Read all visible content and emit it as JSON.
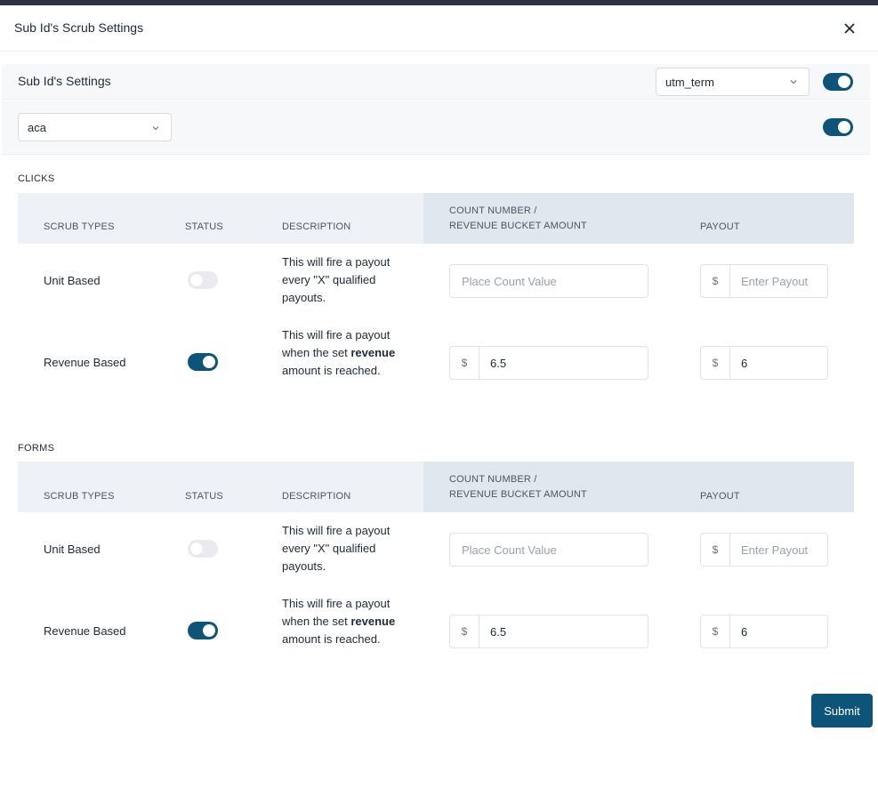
{
  "modal": {
    "title": "Sub Id's Scrub Settings"
  },
  "settings": {
    "title": "Sub Id's Settings",
    "param_select": "utm_term",
    "param_toggle_on": true,
    "sub_id_select": "aca",
    "sub_id_toggle_on": true
  },
  "table_headers": {
    "scrub_types": "SCRUB TYPES",
    "status": "STATUS",
    "description": "DESCRIPTION",
    "count_line1": "COUNT NUMBER /",
    "count_line2": "REVENUE BUCKET AMOUNT",
    "payout": "PAYOUT"
  },
  "currency_symbol": "$",
  "sections": [
    {
      "label": "CLICKS",
      "rows": [
        {
          "type": "Unit Based",
          "status_on": false,
          "description": [
            "This will fire a payout every \"X\" qualified payouts."
          ],
          "count_placeholder": "Place Count Value",
          "count_value": "",
          "payout_placeholder": "Enter Payout",
          "payout_value": ""
        },
        {
          "type": "Revenue Based",
          "status_on": true,
          "description_before": "This will fire a payout when the set ",
          "description_bold": "revenue",
          "description_after": " amount is reached.",
          "count_value": "6.5",
          "payout_value": "6"
        }
      ]
    },
    {
      "label": "FORMS",
      "rows": [
        {
          "type": "Unit Based",
          "status_on": false,
          "description": [
            "This will fire a payout every \"X\" qualified payouts."
          ],
          "count_placeholder": "Place Count Value",
          "count_value": "",
          "payout_placeholder": "Enter Payout",
          "payout_value": ""
        },
        {
          "type": "Revenue Based",
          "status_on": true,
          "description_before": "This will fire a payout when the set ",
          "description_bold": "revenue",
          "description_after": " amount is reached.",
          "count_value": "6.5",
          "payout_value": "6"
        }
      ]
    }
  ],
  "submit_label": "Submit",
  "colors": {
    "accent": "#0e5478",
    "toggle_off": "#e9ebf0",
    "header_bg": "#eef1f6"
  }
}
